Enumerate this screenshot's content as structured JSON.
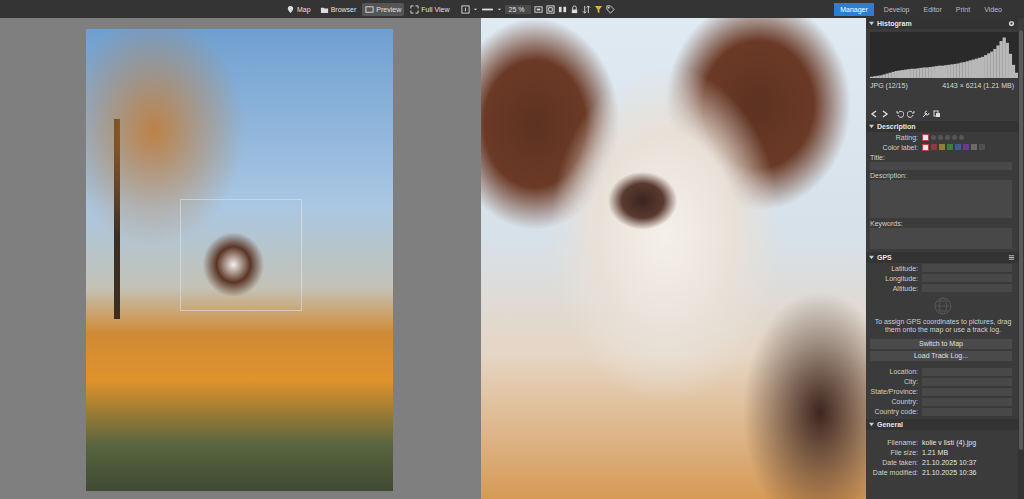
{
  "toolbar": {
    "views": [
      {
        "label": "Map",
        "selected": false
      },
      {
        "label": "Browser",
        "selected": false
      },
      {
        "label": "Preview",
        "selected": true
      },
      {
        "label": "Full View",
        "selected": false
      }
    ],
    "zoom": "25 %"
  },
  "modules": [
    {
      "label": "Manager",
      "selected": true
    },
    {
      "label": "Develop",
      "selected": false
    },
    {
      "label": "Editor",
      "selected": false
    },
    {
      "label": "Print",
      "selected": false
    },
    {
      "label": "Video",
      "selected": false
    }
  ],
  "panel": {
    "histogram": {
      "title": "Histogram",
      "values": [
        3,
        4,
        5,
        6,
        8,
        10,
        12,
        14,
        16,
        17,
        18,
        19,
        20,
        21,
        21,
        22,
        23,
        24,
        24,
        25,
        26,
        27,
        28,
        28,
        29,
        30,
        31,
        32,
        33,
        35,
        36,
        38,
        40,
        42,
        44,
        46,
        48,
        52,
        56,
        60,
        66,
        74,
        84,
        92,
        80,
        55,
        30,
        12
      ],
      "format": "JPG (12/15)",
      "dimensions": "4143 × 6214 (1.21 MB)"
    },
    "description": {
      "title": "Description",
      "rating": {
        "label": "Rating:",
        "stars": 0
      },
      "color_label": {
        "label": "Color label:",
        "colors": [
          {
            "color": "#8a3b3b"
          },
          {
            "color": "#8a7f3b"
          },
          {
            "color": "#3f7a3f"
          },
          {
            "color": "#3b5f8a"
          },
          {
            "color": "#6a3b8a"
          },
          {
            "color": "#6a6a6a"
          },
          {
            "color": "#505050"
          }
        ]
      },
      "fields": [
        {
          "label": "Title:",
          "value": "",
          "kind": "line"
        },
        {
          "label": "Description:",
          "value": "",
          "kind": "box"
        },
        {
          "label": "Keywords:",
          "value": "",
          "kind": "tags"
        }
      ]
    },
    "gps": {
      "title": "GPS",
      "coords": [
        {
          "label": "Latitude:",
          "value": ""
        },
        {
          "label": "Longitude:",
          "value": ""
        },
        {
          "label": "Altitude:",
          "value": ""
        }
      ],
      "hint": "To assign GPS coordinates to pictures, drag them onto the map or use a track log.",
      "buttons": [
        "Switch to Map",
        "Load Track Log..."
      ],
      "location": [
        {
          "label": "Location:",
          "value": ""
        },
        {
          "label": "City:",
          "value": ""
        },
        {
          "label": "State/Province:",
          "value": ""
        },
        {
          "label": "Country:",
          "value": ""
        },
        {
          "label": "Country code:",
          "value": ""
        }
      ]
    },
    "general": {
      "title": "General",
      "rows": [
        {
          "label": "Filename:",
          "value": "kolie v listí (4).jpg"
        },
        {
          "label": "File size:",
          "value": "1.21 MB"
        },
        {
          "label": "Date taken:",
          "value": "21.10.2025 10:37"
        },
        {
          "label": "Date modified:",
          "value": "21.10.2025 10:36"
        }
      ]
    }
  }
}
